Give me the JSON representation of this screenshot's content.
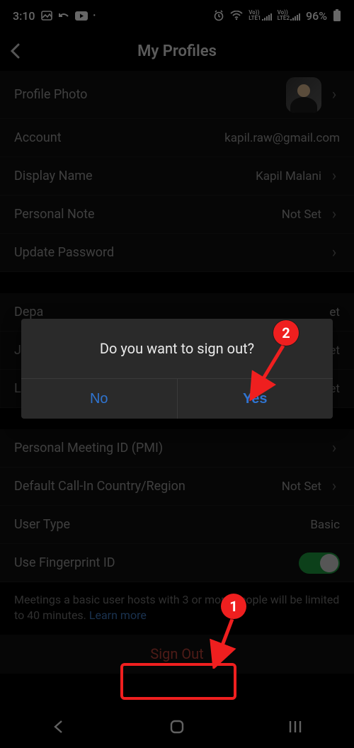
{
  "statusbar": {
    "time": "3:10",
    "battery": "96%"
  },
  "header": {
    "title": "My Profiles"
  },
  "rows": {
    "profile_photo": "Profile Photo",
    "account_label": "Account",
    "account_value": "kapil.raw@gmail.com",
    "display_name_label": "Display Name",
    "display_name_value": "Kapil Malani",
    "personal_note_label": "Personal Note",
    "personal_note_value": "Not Set",
    "update_password": "Update Password",
    "department_label": "Depa",
    "department_value": "et",
    "job_label": "Job",
    "job_value": "et",
    "location_label": "Loca",
    "location_value": "et",
    "pmi": "Personal Meeting ID (PMI)",
    "callin_label": "Default Call-In Country/Region",
    "callin_value": "Not Set",
    "user_type_label": "User Type",
    "user_type_value": "Basic",
    "fingerprint_label": "Use Fingerprint ID"
  },
  "hint": {
    "text": "Meetings a basic user hosts with 3 or more people will be limited to 40 minutes. ",
    "link": "Learn more"
  },
  "signout": "Sign Out",
  "dialog": {
    "message": "Do you want to sign out?",
    "no": "No",
    "yes": "Yes"
  },
  "annotations": {
    "marker1": "1",
    "marker2": "2"
  }
}
